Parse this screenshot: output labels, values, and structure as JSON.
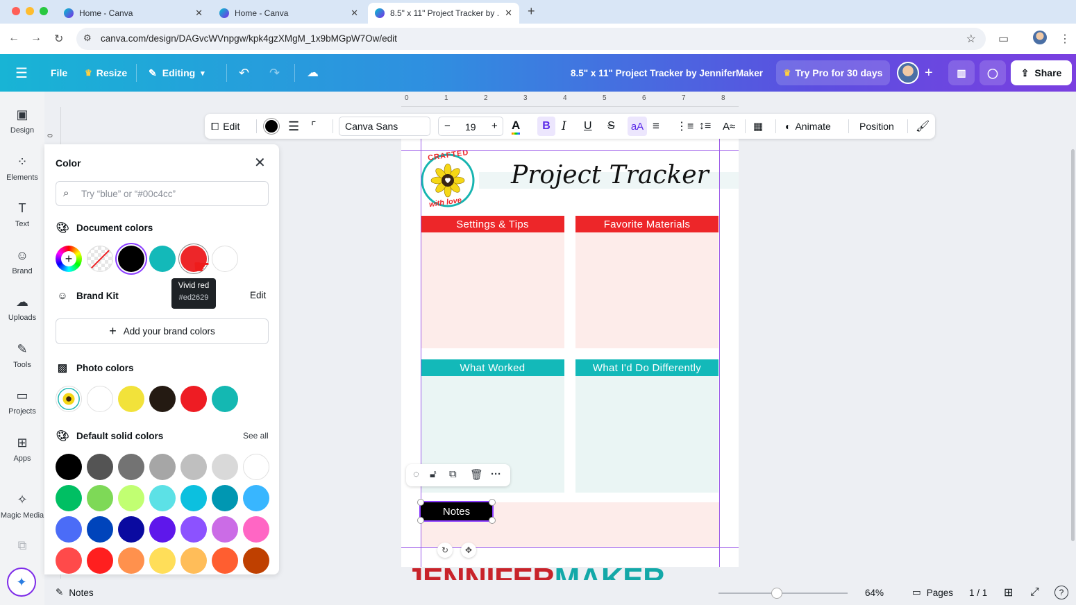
{
  "browser": {
    "tabs": [
      {
        "title": "Home - Canva"
      },
      {
        "title": "Home - Canva"
      },
      {
        "title": "8.5\" x 11\" Project Tracker by ."
      }
    ],
    "url": "canva.com/design/DAGvcWVnpgw/kpk4gzXMgM_1x9bMGpW7Ow/edit"
  },
  "header": {
    "file": "File",
    "resize": "Resize",
    "editing": "Editing",
    "doc_title": "8.5\" x 11\" Project Tracker by JenniferMaker",
    "try_pro": "Try Pro for 30 days",
    "share": "Share"
  },
  "rail": {
    "items": [
      {
        "label": "Design",
        "icon": "design-icon"
      },
      {
        "label": "Elements",
        "icon": "elements-icon"
      },
      {
        "label": "Text",
        "icon": "text-icon"
      },
      {
        "label": "Brand",
        "icon": "brand-icon"
      },
      {
        "label": "Uploads",
        "icon": "uploads-icon"
      },
      {
        "label": "Tools",
        "icon": "tools-icon"
      },
      {
        "label": "Projects",
        "icon": "projects-icon"
      },
      {
        "label": "Apps",
        "icon": "apps-icon"
      },
      {
        "label": "Magic Media",
        "icon": "magic-media-icon"
      }
    ]
  },
  "color_panel": {
    "title": "Color",
    "search_placeholder": "Try “blue” or “#00c4cc”",
    "document_colors_label": "Document colors",
    "document_colors": [
      "#000000",
      "#13b9b9",
      "#ed2629",
      "#ffffff"
    ],
    "tooltip_name": "Vivid red",
    "tooltip_hex": "#ed2629",
    "brand_kit_label": "Brand Kit",
    "brand_kit_edit": "Edit",
    "add_brand_colors": "Add your brand colors",
    "photo_colors_label": "Photo colors",
    "photo_colors": [
      "#ffffff",
      "#f2e23a",
      "#241a12",
      "#ee1c23",
      "#14b8b2"
    ],
    "default_colors_label": "Default solid colors",
    "see_all": "See all",
    "default_colors": [
      [
        "#000000",
        "#545454",
        "#737373",
        "#a6a6a6",
        "#bfbfbf",
        "#d9d9d9",
        "#ffffff"
      ],
      [
        "#00bf63",
        "#7ed957",
        "#c1ff72",
        "#5ce1e6",
        "#0cc0df",
        "#0097b2",
        "#38b6ff"
      ],
      [
        "#4b6cf7",
        "#0044bb",
        "#0a0aa0",
        "#5e17eb",
        "#8c52ff",
        "#cb6ce6",
        "#ff66c4"
      ],
      [
        "#ff4a4a",
        "#ff1f1f",
        "#ff914d",
        "#ffde59",
        "#ffbd59",
        "#ff5e30",
        "#bf4000"
      ]
    ]
  },
  "toolbar": {
    "edit": "Edit",
    "font": "Canva Sans",
    "font_size": "19",
    "animate": "Animate",
    "position": "Position"
  },
  "ruler": {
    "ticks": [
      "0",
      "1",
      "2",
      "3",
      "4",
      "5",
      "6",
      "7",
      "8"
    ],
    "left_tick": "0"
  },
  "design": {
    "logo_top": "CRAFTED",
    "logo_bottom": "with love",
    "title": "Project Tracker",
    "sections": [
      {
        "label": "Settings & Tips",
        "color": "#ed2629"
      },
      {
        "label": "Favorite Materials",
        "color": "#ed2629"
      },
      {
        "label": "What Worked",
        "color": "#13b9b9"
      },
      {
        "label": "What I'd Do Differently",
        "color": "#13b9b9"
      }
    ],
    "notes_label": "Notes"
  },
  "watermark": {
    "part1": "JENNIFER",
    "part2": "MAKER"
  },
  "footer": {
    "notes": "Notes",
    "zoom": "64%",
    "zoom_level": 0.45,
    "pages": "Pages",
    "page_count": "1 / 1"
  }
}
